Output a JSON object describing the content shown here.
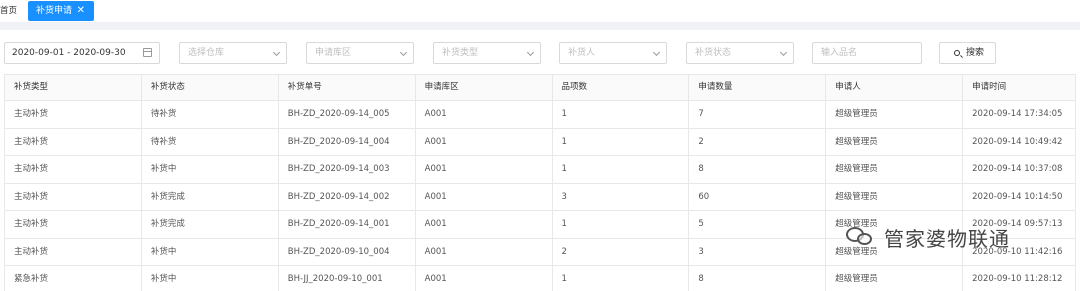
{
  "tabs": {
    "home_label": "首页",
    "active_label": "补货申请",
    "close_glyph": "✕"
  },
  "filters": {
    "date_range": "2020-09-01 - 2020-09-30",
    "warehouse_placeholder": "选择仓库",
    "area_placeholder": "申请库区",
    "type_placeholder": "补货类型",
    "person_placeholder": "补货人",
    "status_placeholder": "补货状态",
    "product_placeholder": "输入品名",
    "search_label": "搜索"
  },
  "table": {
    "columns": [
      "补货类型",
      "补货状态",
      "补货单号",
      "申请库区",
      "品项数",
      "申请数量",
      "申请人",
      "申请时间"
    ],
    "rows": [
      [
        "主动补货",
        "待补货",
        "BH-ZD_2020-09-14_005",
        "A001",
        "1",
        "7",
        "超级管理员",
        "2020-09-14 17:34:05"
      ],
      [
        "主动补货",
        "待补货",
        "BH-ZD_2020-09-14_004",
        "A001",
        "1",
        "2",
        "超级管理员",
        "2020-09-14 10:49:42"
      ],
      [
        "主动补货",
        "补货中",
        "BH-ZD_2020-09-14_003",
        "A001",
        "1",
        "8",
        "超级管理员",
        "2020-09-14 10:37:08"
      ],
      [
        "主动补货",
        "补货完成",
        "BH-ZD_2020-09-14_002",
        "A001",
        "3",
        "60",
        "超级管理员",
        "2020-09-14 10:14:50"
      ],
      [
        "主动补货",
        "补货完成",
        "BH-ZD_2020-09-14_001",
        "A001",
        "1",
        "5",
        "超级管理员",
        "2020-09-14 09:57:13"
      ],
      [
        "主动补货",
        "补货中",
        "BH-ZD_2020-09-10_004",
        "A001",
        "2",
        "3",
        "超级管理员",
        "2020-09-10 11:42:16"
      ],
      [
        "紧急补货",
        "补货中",
        "BH-JJ_2020-09-10_001",
        "A001",
        "1",
        "8",
        "超级管理员",
        "2020-09-10 11:28:12"
      ]
    ]
  },
  "watermark": {
    "text": "管家婆物联通",
    "icon": "wechat-icon"
  },
  "colors": {
    "accent": "#1890ff",
    "border": "#e8e8e8",
    "header_bg": "#fafafa"
  }
}
